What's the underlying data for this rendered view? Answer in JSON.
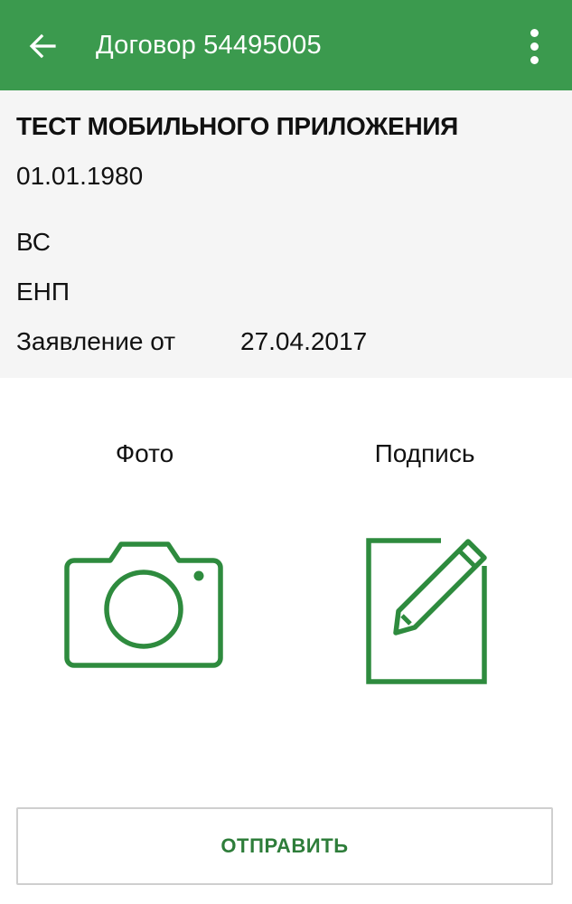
{
  "toolbar": {
    "title": "Договор 54495005",
    "back_icon": "arrow-left-icon",
    "menu_icon": "more-vert-icon",
    "color": "#3b9a4e"
  },
  "info": {
    "client_name": "ТЕСТ МОБИЛЬНОГО ПРИЛОЖЕНИЯ",
    "birth_date": "01.01.1980",
    "doc_type": "ВС",
    "enp": "ЕНП",
    "application_label": "Заявление от",
    "application_date": "27.04.2017"
  },
  "actions": {
    "photo_label": "Фото",
    "photo_icon": "camera-icon",
    "signature_label": "Подпись",
    "signature_icon": "edit-document-icon",
    "icon_color": "#2e8b3e"
  },
  "send_button": {
    "label": "ОТПРАВИТЬ",
    "color": "#2e7d3a"
  }
}
